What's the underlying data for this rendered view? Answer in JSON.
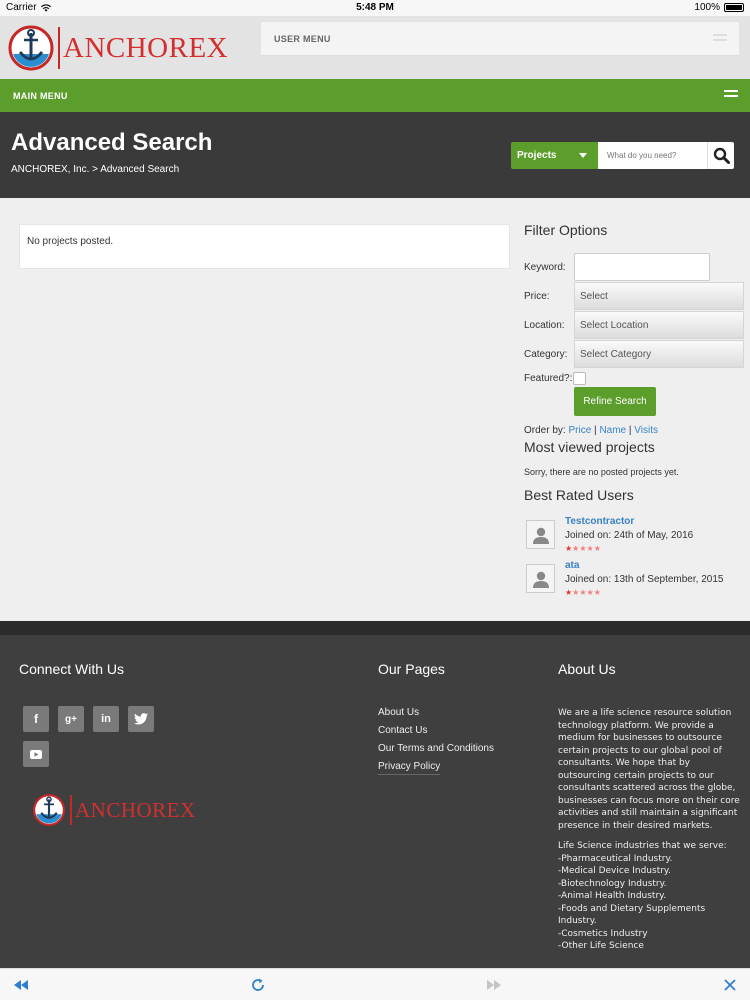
{
  "status_bar": {
    "carrier": "Carrier",
    "time": "5:48 PM",
    "battery": "100%"
  },
  "header": {
    "logo_text": "ANCHOREX",
    "user_menu_label": "USER MENU",
    "main_menu_label": "MAIN MENU"
  },
  "title_band": {
    "title": "Advanced Search",
    "breadcrumb": "ANCHOREX, Inc. > Advanced Search",
    "search_type": "Projects",
    "search_placeholder": "What do you need?"
  },
  "results": {
    "message": "No projects posted."
  },
  "filter": {
    "heading": "Filter Options",
    "keyword_label": "Keyword:",
    "keyword_value": "",
    "price_label": "Price:",
    "price_value": "Select",
    "location_label": "Location:",
    "location_value": "Select Location",
    "category_label": "Category:",
    "category_value": "Select Category",
    "featured_label": "Featured?:",
    "refine_label": "Refine Search",
    "order_by_label": "Order by:",
    "order_price": "Price",
    "order_name": "Name",
    "order_visits": "Visits",
    "sep": "|"
  },
  "most_viewed": {
    "heading": "Most viewed projects",
    "empty": "Sorry, there are no posted projects yet."
  },
  "best_rated": {
    "heading": "Best Rated Users",
    "users": [
      {
        "name": "Testcontractor",
        "joined": "Joined on: 24th of May, 2016",
        "rating": 1
      },
      {
        "name": "ata",
        "joined": "Joined on: 13th of September, 2015",
        "rating": 1
      }
    ]
  },
  "footer": {
    "connect_heading": "Connect With Us",
    "social": [
      "f",
      "g+",
      "in",
      "twitter",
      "youtube"
    ],
    "logo_text": "ANCHOREX",
    "pages_heading": "Our Pages",
    "pages": [
      "About Us",
      "Contact Us",
      "Our Terms and Conditions",
      "Privacy Policy"
    ],
    "about_heading": "About Us",
    "about_paragraph": "We are a life science resource solution technology platform. We provide a medium for businesses to outsource certain projects to our global pool of consultants. We hope that by outsourcing certain projects to our consultants scattered across the globe, businesses can focus more on their core activities and still maintain a significant presence in their desired markets.",
    "industries_intro": "Life Science industries that we serve:",
    "industries": [
      "-Pharmaceutical Industry.",
      "-Medical Device Industry.",
      "-Biotechnology Industry.",
      "-Animal Health Industry.",
      "-Foods and Dietary Supplements Industry.",
      "-Cosmetics Industry",
      "-Other Life Science"
    ]
  },
  "colors": {
    "green": "#5c9e2b",
    "dark": "#3a3a3a",
    "brand_red": "#d32f2f",
    "link_blue": "#3a82c4"
  }
}
